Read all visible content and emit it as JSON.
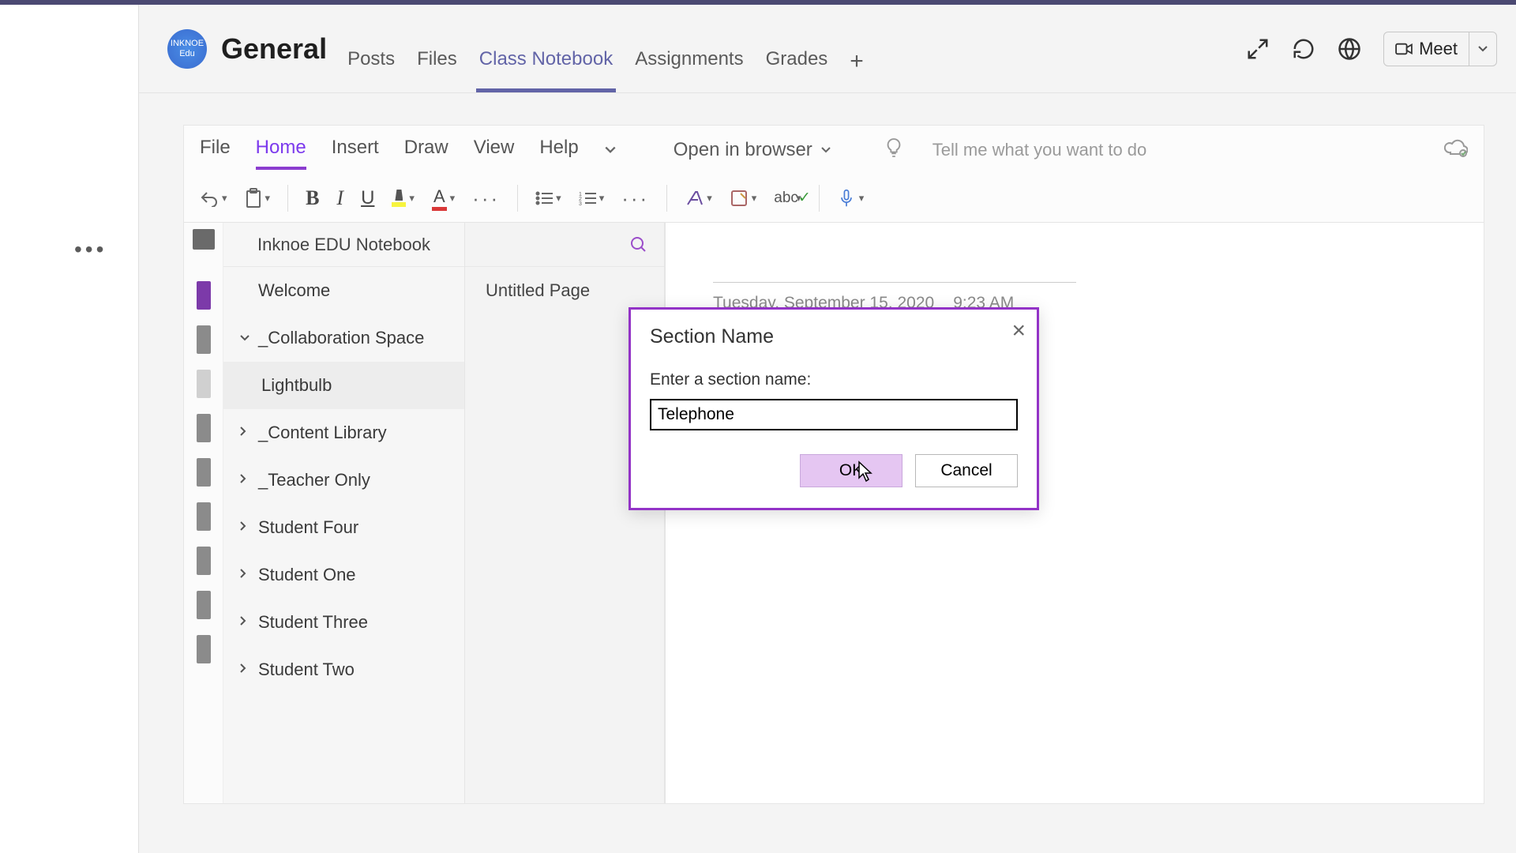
{
  "team": {
    "name_short": "INKNOE Edu"
  },
  "channel": {
    "title": "General"
  },
  "tabs": [
    {
      "label": "Posts",
      "active": false
    },
    {
      "label": "Files",
      "active": false
    },
    {
      "label": "Class Notebook",
      "active": true
    },
    {
      "label": "Assignments",
      "active": false
    },
    {
      "label": "Grades",
      "active": false
    }
  ],
  "meet_button": {
    "label": "Meet"
  },
  "ribbon": {
    "tabs": [
      {
        "label": "File"
      },
      {
        "label": "Home",
        "active": true
      },
      {
        "label": "Insert"
      },
      {
        "label": "Draw"
      },
      {
        "label": "View"
      },
      {
        "label": "Help"
      }
    ],
    "open_browser": "Open in browser",
    "tellme_placeholder": "Tell me what you want to do"
  },
  "notebook": {
    "title": "Inknoe EDU Notebook",
    "sections": [
      {
        "label": "Welcome",
        "expandable": false,
        "child": false
      },
      {
        "label": "_Collaboration Space",
        "expandable": true,
        "expanded": true,
        "child": false
      },
      {
        "label": "Lightbulb",
        "expandable": false,
        "child": true
      },
      {
        "label": "_Content Library",
        "expandable": true,
        "child": false
      },
      {
        "label": "_Teacher Only",
        "expandable": true,
        "child": false
      },
      {
        "label": "Student Four",
        "expandable": true,
        "child": false
      },
      {
        "label": "Student One",
        "expandable": true,
        "child": false
      },
      {
        "label": "Student Three",
        "expandable": true,
        "child": false
      },
      {
        "label": "Student Two",
        "expandable": true,
        "child": false
      }
    ],
    "pages": [
      {
        "label": "Untitled Page"
      }
    ],
    "page_date": "Tuesday, September 15, 2020",
    "page_time": "9:23 AM"
  },
  "dialog": {
    "title": "Section Name",
    "label": "Enter a section name:",
    "value": "Telephone",
    "ok": "OK",
    "cancel": "Cancel"
  }
}
